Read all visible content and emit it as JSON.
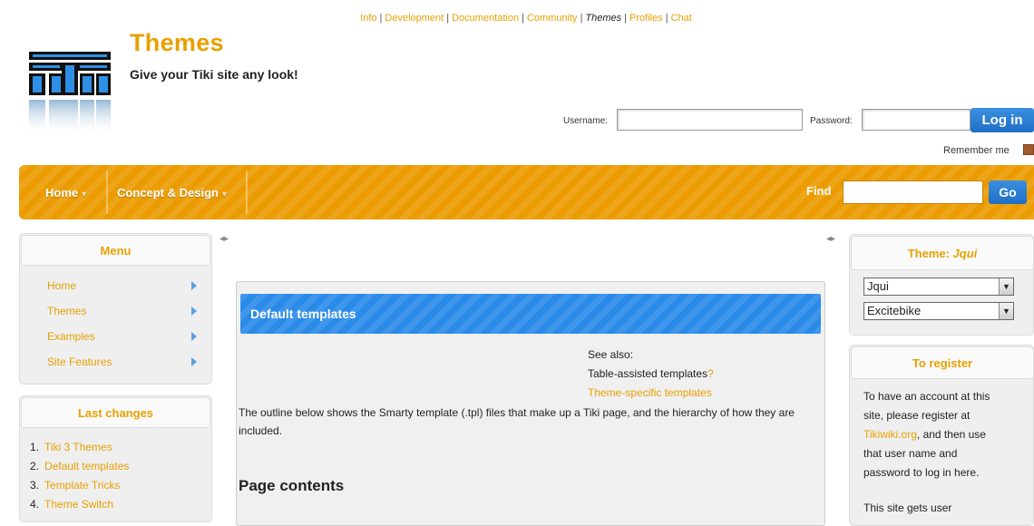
{
  "toplinks": [
    {
      "label": "Info",
      "current": false
    },
    {
      "label": "Development",
      "current": false
    },
    {
      "label": "Documentation",
      "current": false
    },
    {
      "label": "Community",
      "current": false
    },
    {
      "label": "Themes",
      "current": true
    },
    {
      "label": "Profiles",
      "current": false
    },
    {
      "label": "Chat",
      "current": false
    }
  ],
  "site": {
    "title": "Themes",
    "slogan": "Give your Tiki site any look!"
  },
  "login": {
    "username_label": "Username:",
    "password_label": "Password:",
    "button_label": "Log in",
    "remember_label": "Remember me"
  },
  "nav": {
    "items": [
      "Home",
      "Concept & Design"
    ],
    "find_label": "Find",
    "go_label": "Go"
  },
  "menu": {
    "title": "Menu",
    "items": [
      "Home",
      "Themes",
      "Examples",
      "Site Features"
    ]
  },
  "last_changes": {
    "title": "Last changes",
    "items": [
      {
        "num": "1.",
        "text": "Tiki 3 Themes"
      },
      {
        "num": "2.",
        "text": "Default templates"
      },
      {
        "num": "3.",
        "text": "Template Tricks"
      },
      {
        "num": "4.",
        "text": "Theme Switch"
      }
    ]
  },
  "content": {
    "title": "Default templates",
    "see_also": "See also:",
    "see_also_link1": "Table-assisted templates",
    "see_also_link1_suffix": "?",
    "see_also_link2": "Theme-specific templates",
    "paragraph": "The outline below shows the Smarty template (.tpl) files that make up a Tiki page, and the hierarchy of how they are included.",
    "heading": "Page contents"
  },
  "theme_panel": {
    "title_prefix": "Theme: ",
    "title_name": "Jqui",
    "select1": "Jqui",
    "select2": "Excitebike"
  },
  "register_panel": {
    "title": "To register",
    "line1": "To have an account at this",
    "line2": "site, please register at",
    "line3_link": "Tikiwiki.org",
    "line3_rest": ", and then use",
    "line4": "that user name and",
    "line5": "password to log in here.",
    "line6": "This site gets user"
  },
  "colors": {
    "accent": "#e8a000",
    "nav_bg": "#eb9b00",
    "blue_title": "#2a8ae8",
    "button_blue": "#1f6fc5"
  }
}
